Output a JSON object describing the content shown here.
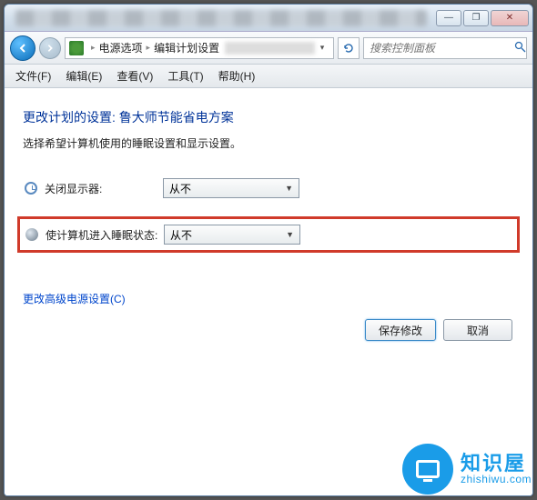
{
  "titlebar": {
    "min": "—",
    "max": "❐",
    "close": "✕"
  },
  "address": {
    "crumb1": "电源选项",
    "crumb2": "编辑计划设置",
    "search_placeholder": "搜索控制面板"
  },
  "menu": {
    "file": "文件(F)",
    "edit": "编辑(E)",
    "view": "查看(V)",
    "tools": "工具(T)",
    "help": "帮助(H)"
  },
  "page": {
    "heading": "更改计划的设置: 鲁大师节能省电方案",
    "subtext": "选择希望计算机使用的睡眠设置和显示设置。",
    "display_off_label": "关闭显示器:",
    "display_off_value": "从不",
    "sleep_label": "使计算机进入睡眠状态:",
    "sleep_value": "从不",
    "advanced_link": "更改高级电源设置(C)",
    "save_btn": "保存修改",
    "cancel_btn": "取消"
  },
  "watermark": {
    "cn": "知识屋",
    "en": "zhishiwu.com"
  }
}
